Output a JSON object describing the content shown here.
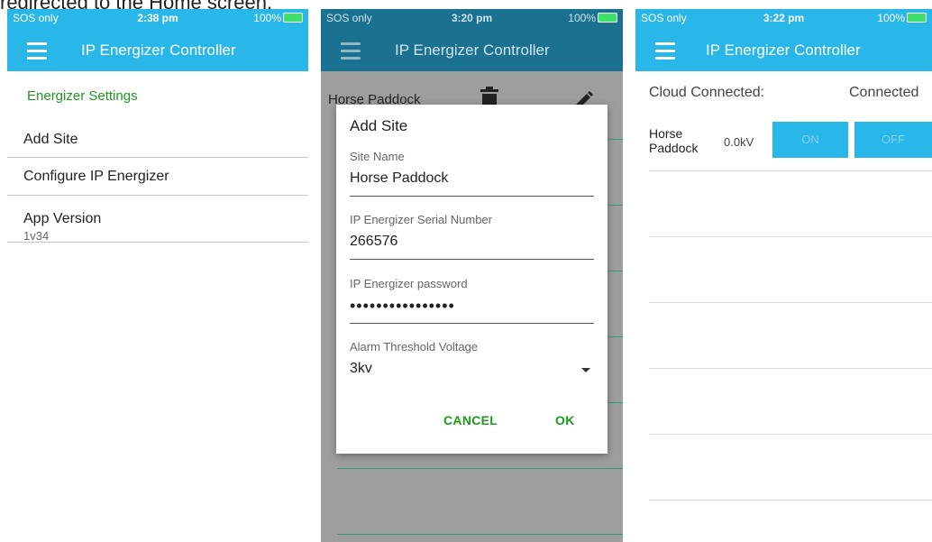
{
  "caption": "redirected to the Home screen.",
  "screens": [
    {
      "status": {
        "carrier": "SOS only",
        "time": "2:38 pm",
        "battery": "100%"
      },
      "title": "IP Energizer Controller",
      "section_header": "Energizer Settings",
      "menu": [
        {
          "label": "Add Site"
        },
        {
          "label": "Configure IP Energizer"
        },
        {
          "label": "App Version",
          "sub": "1v34"
        }
      ]
    },
    {
      "status": {
        "carrier": "SOS only",
        "time": "3:20 pm",
        "battery": "100%"
      },
      "title": "IP Energizer Controller",
      "background_site": "Horse Paddock",
      "icons": [
        "trash-icon",
        "pencil-icon"
      ],
      "dialog": {
        "title": "Add Site",
        "fields": [
          {
            "label": "Site Name",
            "value": "Horse Paddock"
          },
          {
            "label": "IP Energizer Serial Number",
            "value": "266576"
          },
          {
            "label": "IP Energizer password",
            "value": "••••••••••••••••"
          },
          {
            "label": "Alarm Threshold Voltage",
            "value": "3kv"
          }
        ],
        "cancel": "CANCEL",
        "ok": "OK"
      }
    },
    {
      "status": {
        "carrier": "SOS only",
        "time": "3:22 pm",
        "battery": "100%"
      },
      "title": "IP Energizer Controller",
      "cloud_label": "Cloud Connected:",
      "cloud_status": "Connected",
      "site": {
        "name_line1": "Horse",
        "name_line2": "Paddock",
        "voltage": "0.0kV",
        "on": "ON",
        "off": "OFF"
      }
    }
  ],
  "colors": {
    "accent": "#29b6e8",
    "green": "#1e9a1e"
  }
}
